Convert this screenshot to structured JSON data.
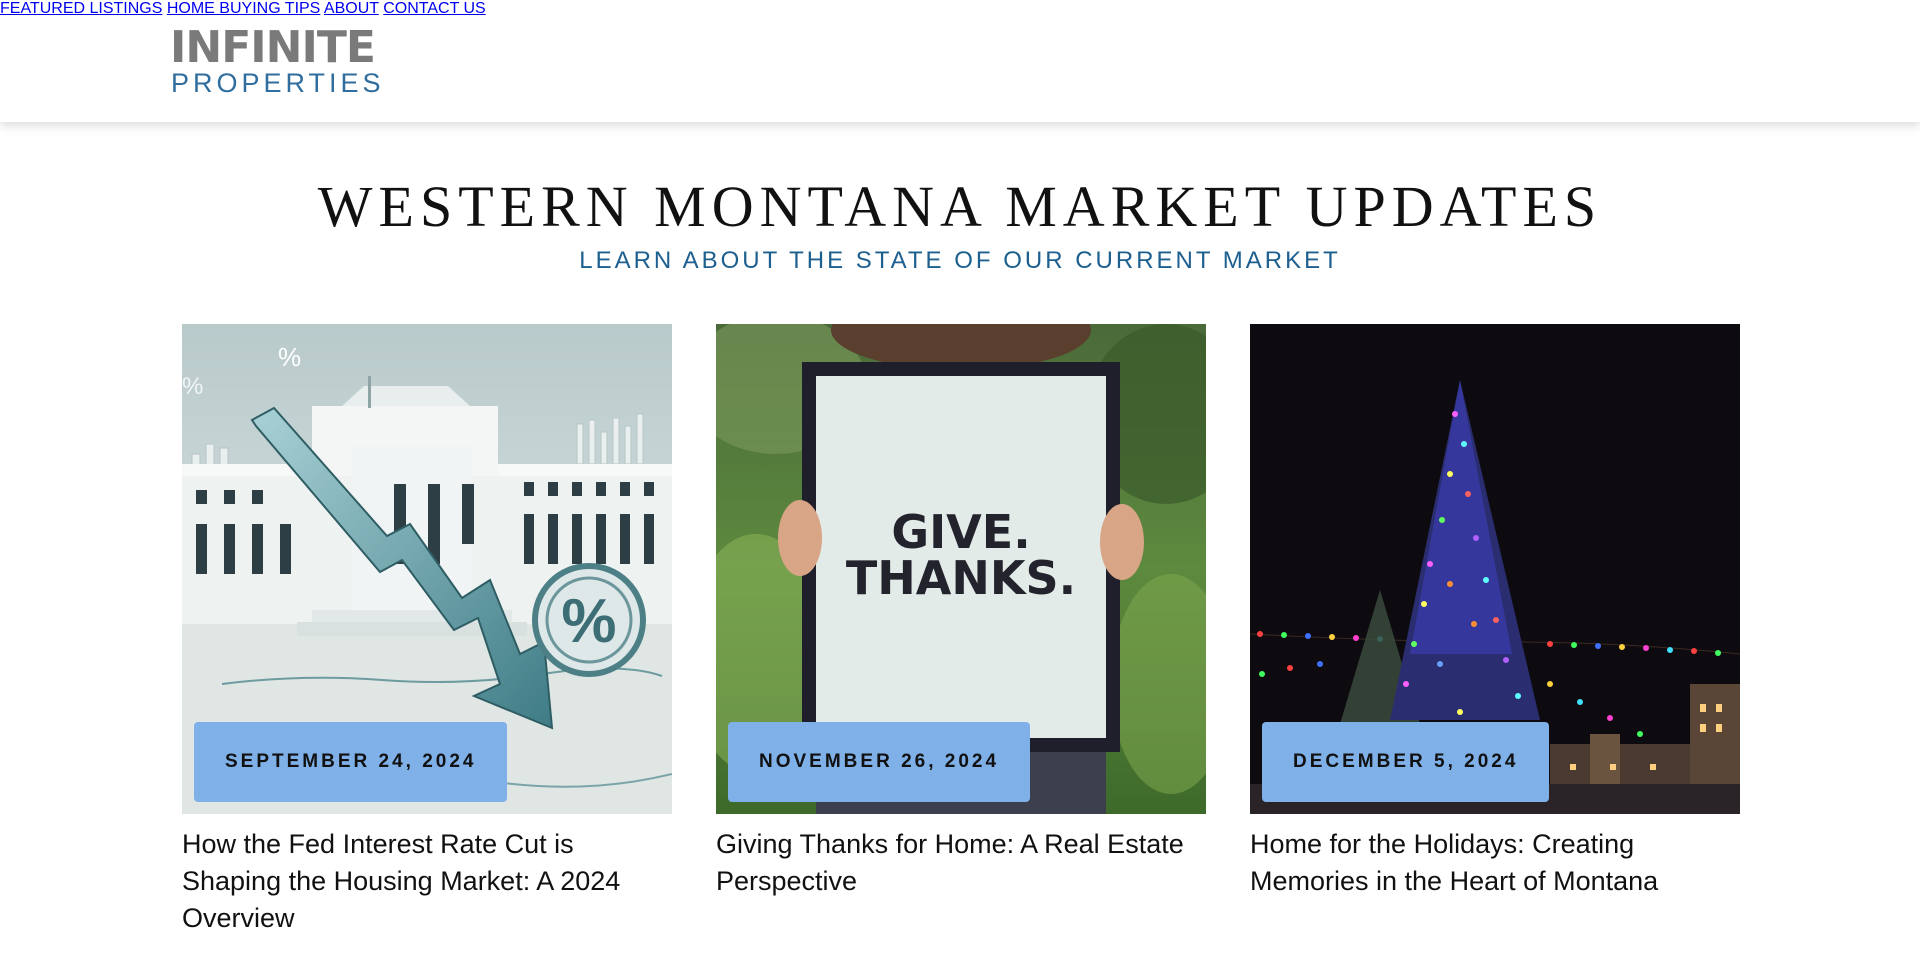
{
  "header": {
    "logo": {
      "word_top": "INFINITE",
      "word_bottom": "PROPERTIES"
    },
    "nav": [
      {
        "label": "FEATURED LISTINGS"
      },
      {
        "label": "HOME BUYING TIPS"
      },
      {
        "label": "ABOUT"
      },
      {
        "label": "CONTACT US"
      }
    ]
  },
  "hero": {
    "title": "WESTERN MONTANA MARKET UPDATES",
    "subtitle": "LEARN ABOUT THE STATE OF OUR CURRENT MARKET"
  },
  "posts": [
    {
      "date": "SEPTEMBER 24, 2024",
      "title": "How the Fed Interest Rate Cut is Shaping the Housing Market: A 2024 Overview",
      "image": "federal-reserve-rate-cut-illustration",
      "image_text": [
        "%",
        "%",
        "%"
      ]
    },
    {
      "date": "NOVEMBER 26, 2024",
      "title": "Giving Thanks for Home: A Real Estate Perspective",
      "image": "person-holding-give-thanks-sign",
      "image_text": [
        "GIVE.",
        "THANKS."
      ]
    },
    {
      "date": "DECEMBER 5, 2024",
      "title": "Home for the Holidays: Creating Memories in the Heart of Montana",
      "image": "lit-christmas-tree-at-night"
    }
  ],
  "colors": {
    "badge": "#7fb0e8",
    "subtitle": "#1d5f8f",
    "logo_gray": "#7a7a7a",
    "logo_blue": "#2f6e9e"
  }
}
